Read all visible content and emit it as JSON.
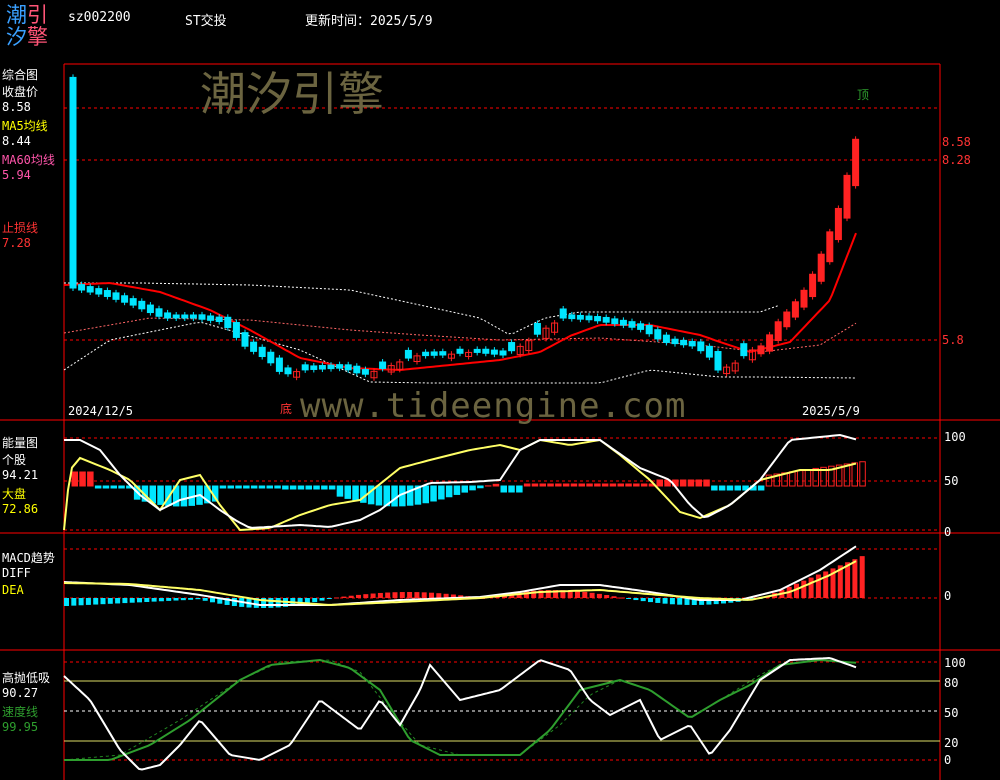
{
  "header": {
    "logo_chars": [
      "潮",
      "引",
      "汐",
      "擎"
    ],
    "stock_code": "sz002200",
    "stock_name": "ST交投",
    "update_label": "更新时间：2025/5/9"
  },
  "watermarks": {
    "brand": "潮汐引擎",
    "url": "www.tideengine.com"
  },
  "colors": {
    "up": "#ff0000",
    "down": "#00ffff",
    "ma5": "#ffff66",
    "ma60": "#ff0000",
    "grid": "#ff0000",
    "white": "#ffffff",
    "green": "#2e9e2e",
    "label_red": "#ff3333",
    "label_yellow": "#ffff00",
    "label_pink": "#ff55aa"
  },
  "panel1": {
    "title": "综合图",
    "close_label": "收盘价",
    "close_value": "8.58",
    "ma5_label": "MA5均线",
    "ma5_value": "8.44",
    "ma60_label": "MA60均线",
    "ma60_value": "5.94",
    "stop_label": "止损线",
    "stop_value": "7.28",
    "axis_labels": [
      "8.58",
      "8.28",
      "5.8"
    ],
    "date_start": "2024/12/5",
    "date_end": "2025/5/9",
    "top_marker": "顶",
    "bottom_marker": "底"
  },
  "panel2": {
    "title": "能量图",
    "stock_label": "个股",
    "stock_value": "94.21",
    "market_label": "大盘",
    "market_value": "72.86",
    "axis_labels": [
      "100",
      "50",
      "0"
    ]
  },
  "panel3": {
    "title": "MACD趋势",
    "diff_label": "DIFF",
    "dea_label": "DEA",
    "axis_labels": [
      "0"
    ]
  },
  "panel4": {
    "title": "高抛低吸",
    "value1": "90.27",
    "speed_label": "速度线",
    "speed_value": "99.95",
    "axis_labels": [
      "100",
      "80",
      "50",
      "20",
      "0"
    ]
  },
  "chart_data": {
    "type": "line",
    "x_range": [
      "2024/12/5",
      "2025/5/9"
    ],
    "price": {
      "close_approx": [
        6.45,
        6.43,
        6.4,
        6.38,
        6.35,
        6.2,
        6.15,
        6.1,
        6.12,
        6.15,
        6.13,
        6.1,
        6.05,
        5.9,
        5.82,
        5.78,
        5.7,
        5.6,
        5.55,
        5.52,
        5.56,
        5.6,
        5.6,
        5.6,
        5.58,
        5.55,
        5.52,
        5.53,
        5.56,
        5.6,
        5.65,
        5.72,
        5.75,
        5.73,
        5.74,
        5.73,
        5.72,
        5.68,
        5.67,
        5.72,
        5.8,
        5.88,
        5.98,
        6.05,
        6.1,
        6.12,
        6.1,
        6.08,
        6.07,
        6.02,
        5.98,
        5.96,
        5.95,
        5.92,
        5.9,
        5.88,
        5.83,
        5.75,
        5.6,
        5.6,
        5.65,
        5.7,
        5.8,
        5.9,
        6.05,
        6.25,
        6.55,
        6.85,
        7.15,
        7.45,
        7.75,
        8.05,
        8.3,
        8.58
      ],
      "axis_values": [
        8.58,
        8.28,
        5.8
      ]
    },
    "energy": {
      "stock": 94.21,
      "market": 72.86,
      "levels": [
        100,
        50,
        0
      ]
    },
    "speed": {
      "value1": 90.27,
      "speed": 99.95,
      "levels": [
        100,
        80,
        50,
        20,
        0
      ]
    }
  }
}
